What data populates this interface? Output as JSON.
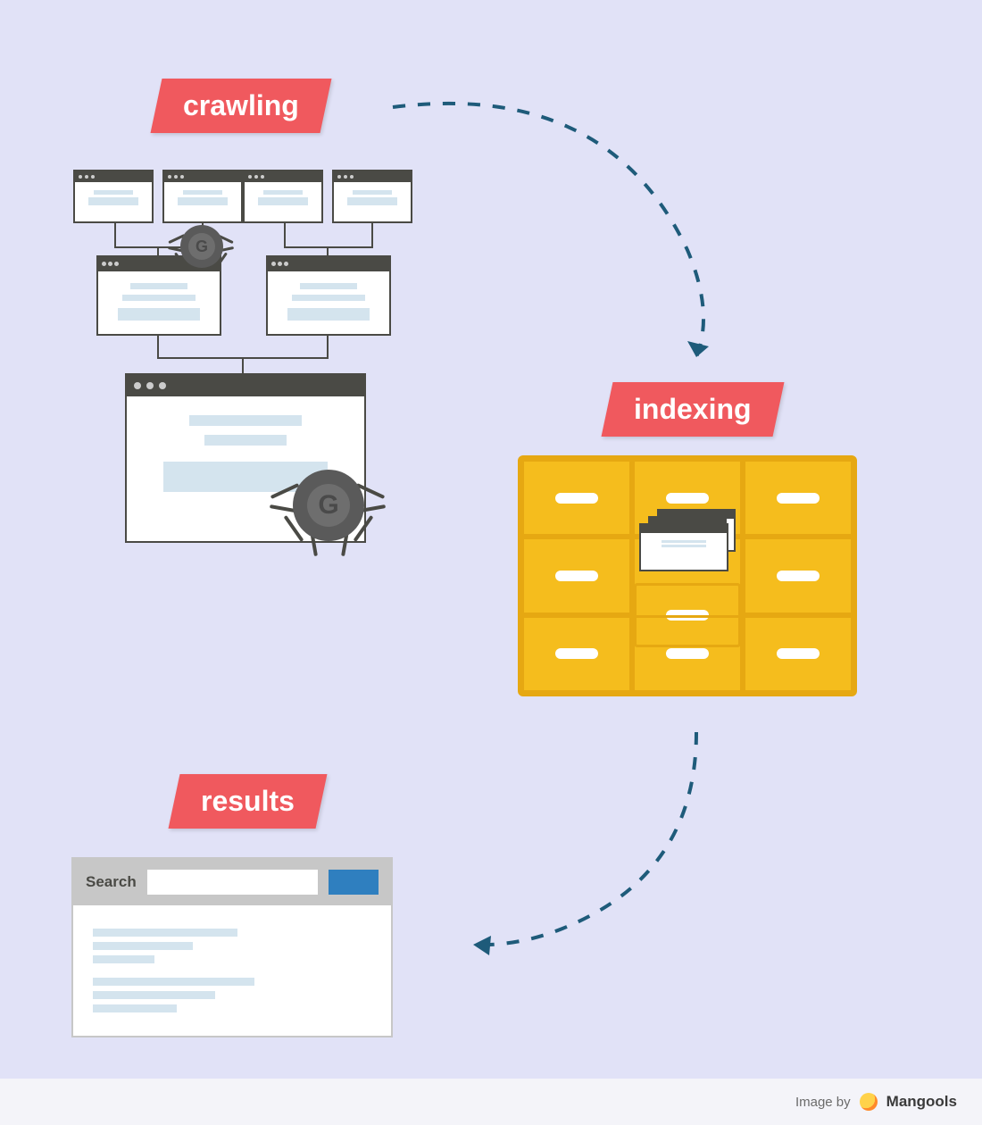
{
  "labels": {
    "crawling": "crawling",
    "indexing": "indexing",
    "results": "results"
  },
  "results": {
    "search_label": "Search"
  },
  "footer": {
    "prefix": "Image by",
    "brand": "Mangools"
  },
  "colors": {
    "background": "#e1e2f7",
    "tag": "#f0595e",
    "cabinet": "#f5bd1d",
    "arrow": "#1e5b7a",
    "search_button": "#2f7fbf"
  }
}
